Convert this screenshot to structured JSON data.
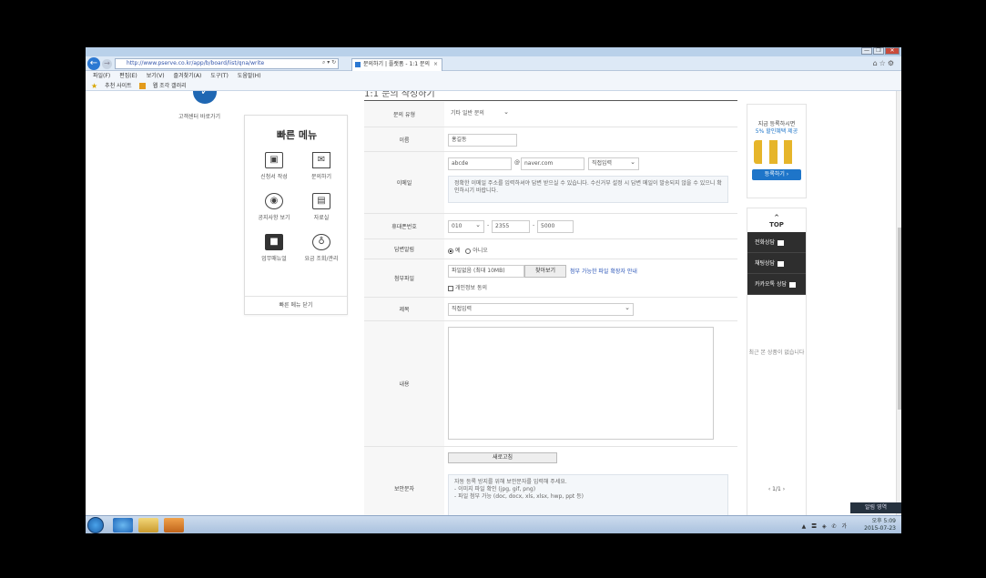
{
  "browser": {
    "url": "http://www.pserve.co.kr/app/b/board/list/qna/write",
    "tab_title": "문의하기 | 플랫폼 - 1:1 문의",
    "menu": [
      "파일(F)",
      "편집(E)",
      "보기(V)",
      "즐겨찾기(A)",
      "도구(T)",
      "도움말(H)"
    ],
    "favorites": [
      "추천 사이트",
      "웹 조각 갤러리"
    ],
    "window_controls": [
      "—",
      "❐",
      "✕"
    ]
  },
  "header": {
    "logo_text": "고객센터 바로가기",
    "form_title": "1:1 문의 작성하기"
  },
  "quick_menu": {
    "title": "빠른 메뉴",
    "items": [
      {
        "icon": "document-icon",
        "glyph": "▣",
        "label": "신청서 작성"
      },
      {
        "icon": "mail-icon",
        "glyph": "✉",
        "label": "문의하기"
      },
      {
        "icon": "podcast-icon",
        "glyph": "◉",
        "label": "공지사항 보기"
      },
      {
        "icon": "laptop-icon",
        "glyph": "▤",
        "label": "자료실"
      },
      {
        "icon": "briefcase-icon",
        "glyph": "■",
        "label": "업무매뉴얼"
      },
      {
        "icon": "piggybank-icon",
        "glyph": "♁",
        "label": "요금 조회/관리"
      }
    ],
    "footer": "빠른 메뉴 닫기"
  },
  "form": {
    "type_label": "문의 유형",
    "type_value": "기타 일반 문의",
    "name_label": "이름",
    "name_value": "홍길동",
    "email_label": "이메일",
    "email_id": "abcde",
    "email_domain": "naver.com",
    "email_select": "직접입력",
    "email_notice": "정확한 이메일 주소를 입력하셔야 답변 받으실 수 있습니다. 수신거부 설정 시 답변 메일이 발송되지 않을 수 있으니 확인하시기 바랍니다.",
    "phone_label": "휴대폰번호",
    "phone_1": "010",
    "phone_2": "2355",
    "phone_3": "5000",
    "sms_label": "답변알림",
    "sms_yes": "예",
    "sms_no": "아니오",
    "attach_label": "첨부파일",
    "attach_value": "파일없음 (최대 10MB)",
    "attach_button": "찾아보기",
    "attach_note": "첨부 가능한 파일 확장자 안내",
    "agree_label": "개인정보 동의",
    "subject_label": "제목",
    "subject_value": "직접입력",
    "content_label": "내용",
    "security_label": "보안문자",
    "security_button": "새로고침",
    "security_notice_1": "자동 등록 방지를 위해 보안문자를 입력해 주세요.",
    "security_notice_2": "- 이미지 파일 확인 (jpg, gif, png)",
    "security_notice_3": "- 파일 첨부 가능 (doc, docx, xls, xlsx, hwp, ppt 등)"
  },
  "ad": {
    "line1": "지금 등록하시면",
    "line2": "5% 할인혜택 제공",
    "button": "등록하기 ›"
  },
  "side_panel": {
    "top": "TOP",
    "items": [
      "전화상담",
      "채팅상담",
      "카카오톡 상담"
    ],
    "recent": "최근 본 상품이 없습니다",
    "pager": "‹ 1/1 ›"
  },
  "taskbar": {
    "time": "오후 5:09",
    "date": "2015-07-23",
    "tray": "▲ 〓 ◈ ✆ 가",
    "notification": "알림 영역"
  },
  "colors": {
    "accent": "#1e75c9",
    "dark_panel": "#2e2e2e",
    "titlebar": "#b9d1ea"
  }
}
